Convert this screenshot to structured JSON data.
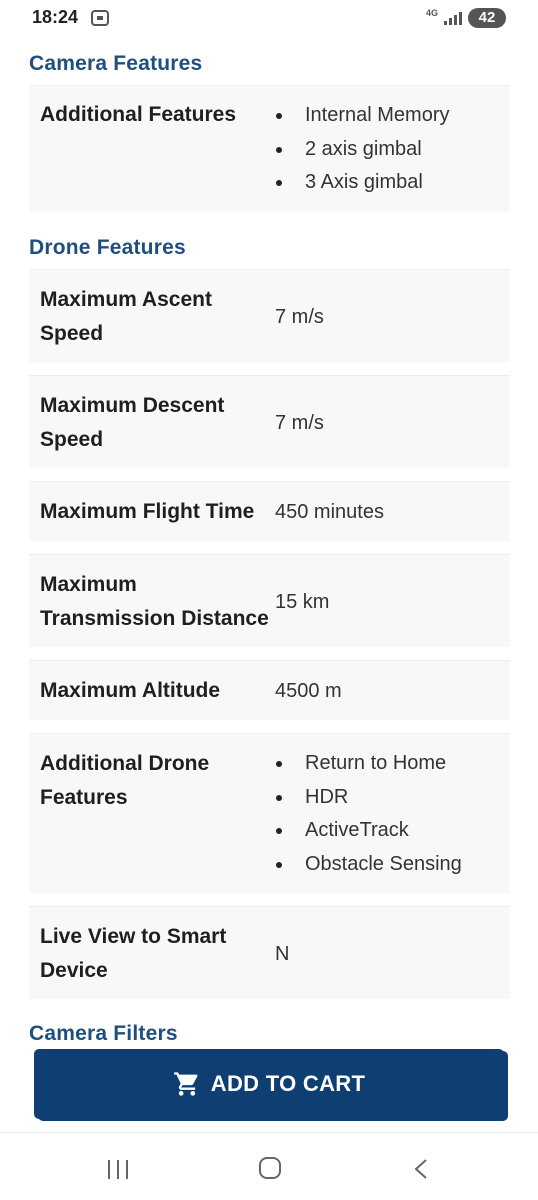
{
  "status_bar": {
    "time": "18:24",
    "network": "4G",
    "battery": "42"
  },
  "sections": [
    {
      "title": "Camera Features",
      "rows": [
        {
          "label": "Additional Features",
          "values": [
            "Internal Memory",
            "2 axis gimbal",
            "3 Axis gimbal"
          ]
        }
      ]
    },
    {
      "title": "Drone Features",
      "rows": [
        {
          "label": "Maximum Ascent Speed",
          "value": "7 m/s"
        },
        {
          "label": "Maximum Descent Speed",
          "value": "7 m/s"
        },
        {
          "label": "Maximum Flight Time",
          "value": "450 minutes"
        },
        {
          "label": "Maximum Transmission Distance",
          "value": "15 km"
        },
        {
          "label": "Maximum Altitude",
          "value": "4500 m"
        },
        {
          "label": "Additional Drone Features",
          "values": [
            "Return to Home",
            "HDR",
            "ActiveTrack",
            "Obstacle Sensing"
          ]
        },
        {
          "label": "Live View to Smart Device",
          "value": "N"
        }
      ]
    },
    {
      "title": "Camera Filters",
      "rows": []
    }
  ],
  "cart_button": {
    "label": "ADD TO CART"
  },
  "icons": {
    "notification": "screenshot-notification-icon",
    "signal": "signal-strength-icon",
    "battery": "battery-icon",
    "cart": "shopping-cart-icon",
    "recents": "recent-apps-icon",
    "home": "home-icon",
    "back": "back-icon"
  },
  "colors": {
    "section_title": "#1f4f7e",
    "button_background": "#0f3e73",
    "row_background": "#f8f8f8"
  }
}
